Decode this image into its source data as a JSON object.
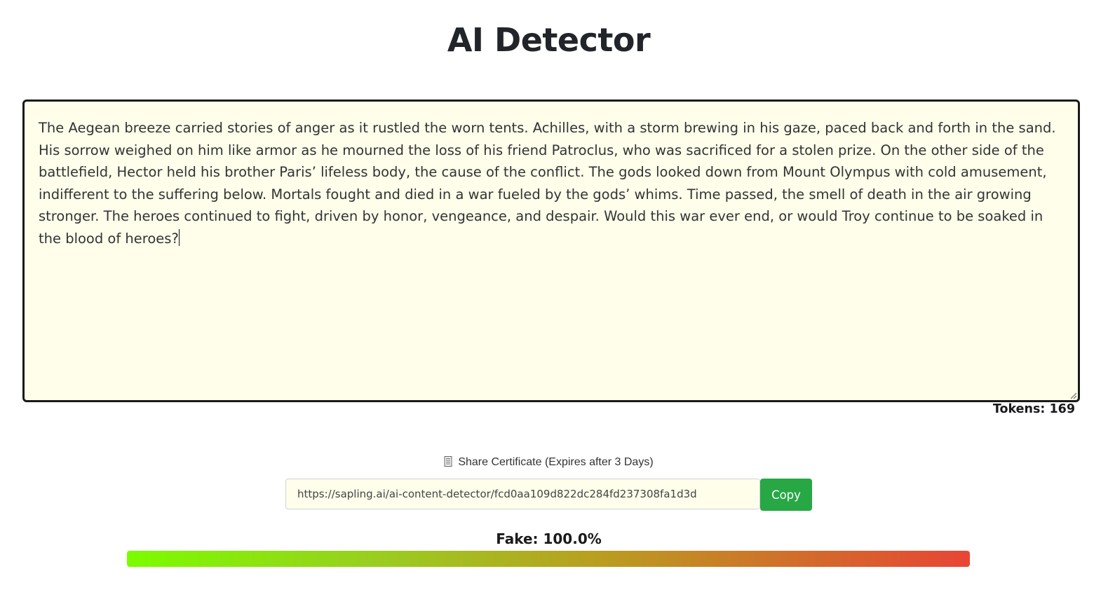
{
  "header": {
    "title": "AI Detector"
  },
  "editor": {
    "text": "The Aegean breeze carried stories of anger as it rustled the worn tents. Achilles, with a storm brewing in his gaze, paced back and forth in the sand. His sorrow weighed on him like armor as he mourned the loss of his friend Patroclus, who was sacrificed for a stolen prize. On the other side of the battlefield, Hector held his brother Paris’ lifeless body, the cause of the conflict. The gods looked down from Mount Olympus with cold amusement, indifferent to the suffering below. Mortals fought and died in a war fueled by the gods’ whims. Time passed, the smell of death in the air growing stronger. The heroes continued to fight, driven by honor, vengeance, and despair. Would this war ever end, or would Troy continue to be soaked in the blood of heroes?",
    "tokens_label": "Tokens: 169"
  },
  "share": {
    "icon": "document-icon",
    "label": "Share Certificate (Expires after 3 Days)",
    "url": "https://sapling.ai/ai-content-detector/fcd0aa109d822dc284fd237308fa1d3d",
    "copy_label": "Copy"
  },
  "result": {
    "fake_label": "Fake: 100.0%",
    "fake_fraction": 1.0
  },
  "colors": {
    "accent_button": "#28a745",
    "editor_background": "#fefeeb",
    "bar_start": "#7cfc00",
    "bar_end": "#e84535"
  }
}
